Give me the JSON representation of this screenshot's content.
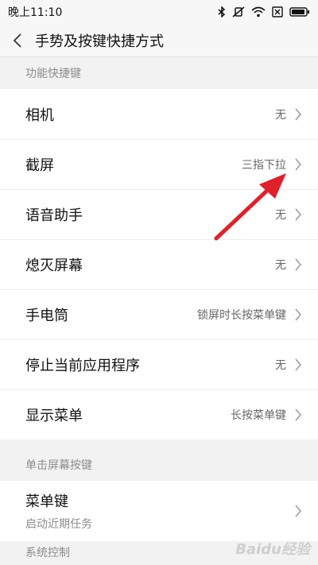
{
  "status_bar": {
    "time": "晚上11:10",
    "icons": [
      "bluetooth-icon",
      "vibrate-off-icon",
      "wifi-icon",
      "sim-off-icon",
      "battery-icon"
    ]
  },
  "header": {
    "back_icon": "chevron-left-icon",
    "title": "手势及按键快捷方式"
  },
  "sections": [
    {
      "title": "功能快捷键",
      "items": [
        {
          "label": "相机",
          "value": "无"
        },
        {
          "label": "截屏",
          "value": "三指下拉"
        },
        {
          "label": "语音助手",
          "value": "无"
        },
        {
          "label": "熄灭屏幕",
          "value": "无"
        },
        {
          "label": "手电筒",
          "value": "锁屏时长按菜单键"
        },
        {
          "label": "停止当前应用程序",
          "value": "无"
        },
        {
          "label": "显示菜单",
          "value": "长按菜单键"
        }
      ]
    },
    {
      "title": "单击屏幕按键",
      "items": [
        {
          "label": "菜单键",
          "subtitle": "启动近期任务"
        }
      ]
    },
    {
      "title": "系统控制",
      "items": []
    }
  ],
  "annotation": {
    "color": "#e0202a"
  },
  "watermark": "Baidu经验"
}
